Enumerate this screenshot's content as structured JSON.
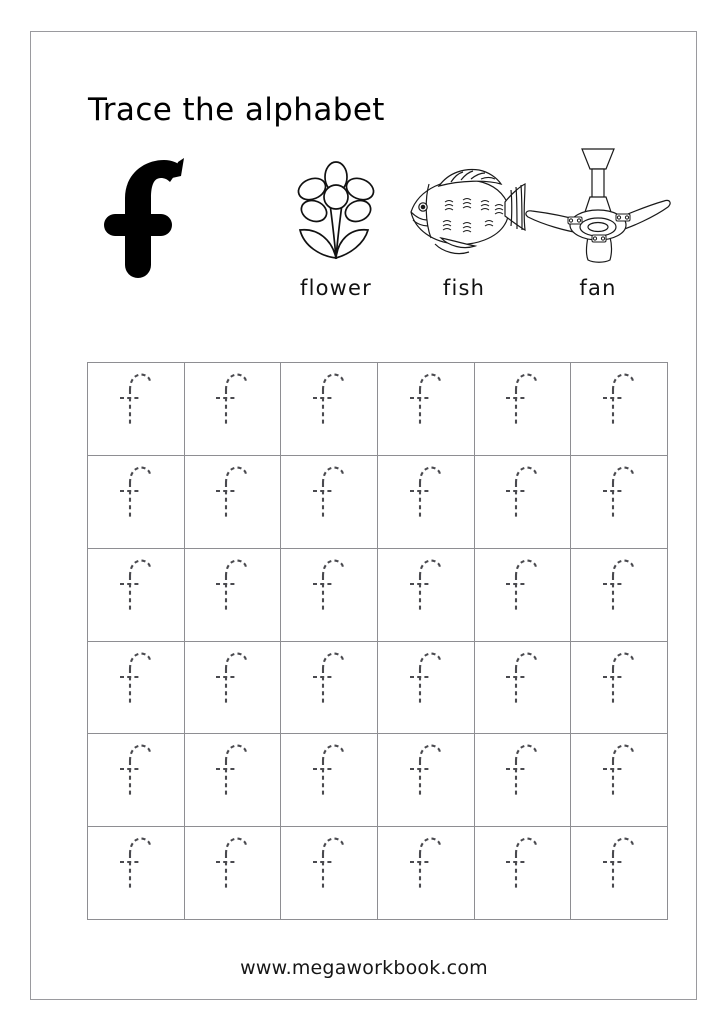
{
  "page": {
    "title": "Trace the alphabet",
    "footer": "www.megaworkbook.com",
    "border_color": "#9a9a9e",
    "background": "#ffffff"
  },
  "hero": {
    "letter": "f",
    "letter_case": "lowercase",
    "icon": "letter-f-solid-icon",
    "color": "#000000"
  },
  "pictures": [
    {
      "label": "flower",
      "icon": "flower-icon"
    },
    {
      "label": "fish",
      "icon": "fish-icon"
    },
    {
      "label": "fan",
      "icon": "ceiling-fan-icon"
    }
  ],
  "grid": {
    "rows": 6,
    "columns": 6,
    "total_cells": 36,
    "trace_letter": "f",
    "trace_style": "dotted",
    "line_color": "#8e8e92",
    "dot_color": "#4a4a4f"
  }
}
